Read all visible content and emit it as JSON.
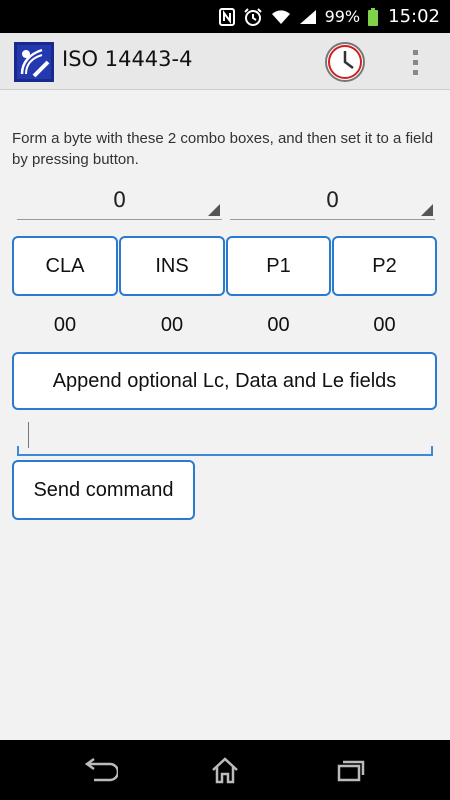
{
  "status_bar": {
    "battery_pct": "99%",
    "time": "15:02",
    "icons": [
      "nfc-icon",
      "alarm-icon",
      "wifi-icon",
      "signal-icon",
      "battery-icon"
    ]
  },
  "action_bar": {
    "title": "ISO 14443-4",
    "app_icon": "nfc-app-icon",
    "history_icon": "clock-icon",
    "overflow_icon": "overflow-menu-icon"
  },
  "main": {
    "instruction": "Form a byte with these 2 combo boxes, and then set it to a field by pressing button.",
    "spinners": [
      {
        "selected": "0"
      },
      {
        "selected": "0"
      }
    ],
    "fields": [
      {
        "label": "CLA",
        "value": "00"
      },
      {
        "label": "INS",
        "value": "00"
      },
      {
        "label": "P1",
        "value": "00"
      },
      {
        "label": "P2",
        "value": "00"
      }
    ],
    "append_label": "Append optional Lc, Data and Le fields",
    "command_input": {
      "value": "",
      "placeholder": ""
    },
    "send_label": "Send command"
  },
  "nav_bar": {
    "icons": [
      "back-icon",
      "home-icon",
      "recent-apps-icon"
    ]
  },
  "colors": {
    "accent": "#2a7ad0",
    "status_bar": "#000000",
    "action_bar": "#e8e8e8",
    "background": "#f2f2f2"
  }
}
